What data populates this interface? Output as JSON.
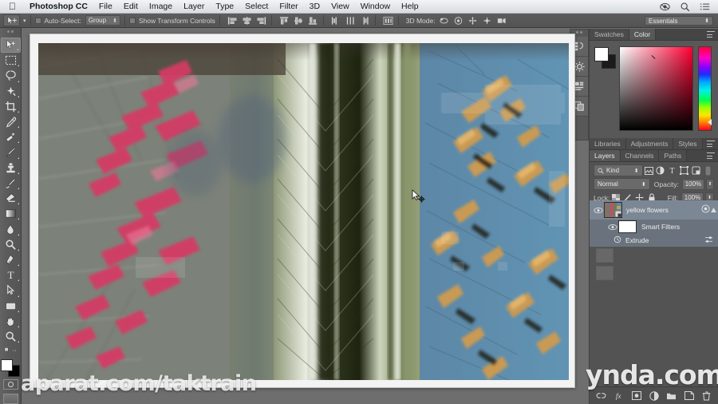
{
  "menubar": {
    "apple_icon": "apple-logo-icon",
    "app_name": "Photoshop CC",
    "items": [
      "File",
      "Edit",
      "Image",
      "Layer",
      "Type",
      "Select",
      "Filter",
      "3D",
      "View",
      "Window",
      "Help"
    ],
    "right_icons": [
      "screen-share-icon",
      "search-icon",
      "notification-list-icon"
    ]
  },
  "options_bar": {
    "tool_icon": "move-tool-icon",
    "tool_caret": "▾",
    "auto_select_label": "Auto-Select:",
    "auto_select_value": "Group",
    "auto_select_caret": "⬍",
    "show_transform_label": "Show Transform Controls",
    "align_icons": [
      "align-left-edges-icon",
      "align-horizontal-centers-icon",
      "align-right-edges-icon",
      "align-top-edges-icon",
      "align-vertical-centers-icon",
      "align-bottom-edges-icon",
      "distribute-left-icon",
      "distribute-horizontal-center-icon",
      "distribute-right-icon",
      "distribute-top-icon",
      "distribute-vertical-center-icon",
      "distribute-bottom-icon",
      "auto-align-layers-icon"
    ],
    "mode_3d_label": "3D Mode:",
    "mode_3d_icons": [
      "rotate-3d-icon",
      "roll-3d-icon",
      "drag-3d-icon",
      "slide-3d-icon",
      "scale-3d-icon"
    ],
    "workspace_value": "Essentials",
    "workspace_caret": "⬍"
  },
  "toolbar": {
    "tools": [
      {
        "name": "move-tool",
        "active": true
      },
      {
        "name": "rectangular-marquee-tool",
        "active": false
      },
      {
        "name": "lasso-tool",
        "active": false
      },
      {
        "name": "quick-selection-tool",
        "active": false
      },
      {
        "name": "crop-tool",
        "active": false
      },
      {
        "name": "eyedropper-tool",
        "active": false
      },
      {
        "name": "spot-healing-brush-tool",
        "active": false
      },
      {
        "name": "brush-tool",
        "active": false
      },
      {
        "name": "clone-stamp-tool",
        "active": false
      },
      {
        "name": "history-brush-tool",
        "active": false
      },
      {
        "name": "eraser-tool",
        "active": false
      },
      {
        "name": "gradient-tool",
        "active": false
      },
      {
        "name": "blur-tool",
        "active": false
      },
      {
        "name": "dodge-tool",
        "active": false
      },
      {
        "name": "pen-tool",
        "active": false
      },
      {
        "name": "horizontal-type-tool",
        "active": false
      },
      {
        "name": "path-selection-tool",
        "active": false
      },
      {
        "name": "rectangle-tool",
        "active": false
      },
      {
        "name": "hand-tool",
        "active": false
      },
      {
        "name": "zoom-tool",
        "active": false
      }
    ],
    "edit_toolbar_icon": "edit-toolbar-icon",
    "foreground_color": "#ffffff",
    "background_color": "#000000",
    "quick_mask_icon": "quick-mask-icon",
    "screen_mode_icon": "screen-mode-icon"
  },
  "panel_rail": {
    "buttons": [
      "history-panel-icon",
      "actions-panel-icon",
      "character-panel-icon",
      "properties-panel-icon"
    ]
  },
  "color_panel": {
    "tabs": [
      {
        "label": "Swatches",
        "active": false
      },
      {
        "label": "Color",
        "active": true
      }
    ],
    "foreground_color": "#ffffff",
    "background_color": "#1b1b1b",
    "picker_hue": "#ff0033"
  },
  "upper_panel_tabs": [
    {
      "label": "Libraries",
      "active": false
    },
    {
      "label": "Adjustments",
      "active": false
    },
    {
      "label": "Styles",
      "active": false
    }
  ],
  "layers_panel": {
    "tabs": [
      {
        "label": "Layers",
        "active": true
      },
      {
        "label": "Channels",
        "active": false
      },
      {
        "label": "Paths",
        "active": false
      }
    ],
    "filter_label": "Kind",
    "filter_caret": "⬍",
    "filter_icons": [
      "filter-pixel-icon",
      "filter-adjustment-icon",
      "filter-type-icon",
      "filter-shape-icon",
      "filter-smart-object-icon"
    ],
    "filter_toggle_icon": "filter-power-icon",
    "blend_mode": "Normal",
    "blend_caret": "⬍",
    "opacity_label": "Opacity:",
    "opacity_value": "100%",
    "lock_label": "Lock:",
    "lock_icons": [
      "lock-transparent-pixels-icon",
      "lock-image-pixels-icon",
      "lock-position-icon",
      "lock-all-icon"
    ],
    "fill_label": "Fill:",
    "fill_value": "100%",
    "stepper_caret": "⬍",
    "layers": [
      {
        "name": "yellow flowers",
        "visible": true,
        "selected": true,
        "smart_object": true,
        "thumb_icon": "layer-thumbnail",
        "smart_object_badge": "smart-object-badge-icon",
        "smart_filters": {
          "label": "Smart Filters",
          "visible": true,
          "effects": [
            {
              "label": "Extrude",
              "visible": true,
              "settings_icon": "filter-settings-icon"
            }
          ]
        }
      },
      {
        "name": "",
        "visible": false,
        "selected": false,
        "ghost": true
      },
      {
        "name": "",
        "visible": false,
        "selected": false,
        "ghost": true
      }
    ],
    "bottom_icons": [
      "link-layers-icon",
      "add-layer-style-icon",
      "add-layer-mask-icon",
      "new-adjustment-layer-icon",
      "new-group-icon",
      "new-layer-icon",
      "delete-layer-icon"
    ]
  },
  "document": {
    "title": "",
    "image_description": "extrude-filter-blurred-flowers"
  },
  "watermarks": {
    "left": "aparat.com/taktrain",
    "right": "ynda.com"
  },
  "colors": {
    "menubar_bg": "#e6eaec",
    "chrome_bg": "#565656",
    "panel_bg": "#535353",
    "selected_layer": "#7b8794",
    "accent_text": "#eaeaea"
  }
}
